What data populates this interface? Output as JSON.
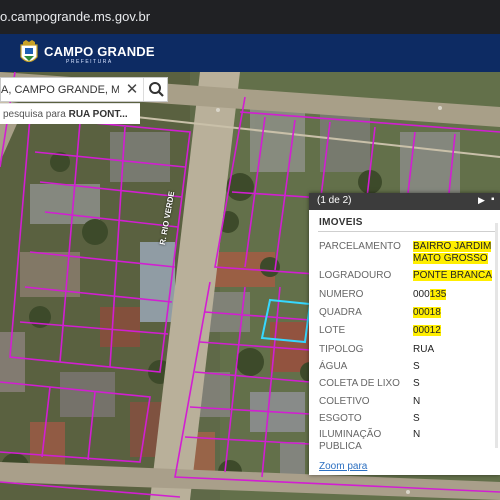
{
  "browser": {
    "url": "o.campogrande.ms.gov.br"
  },
  "header": {
    "title": "CAMPO GRANDE",
    "subtitle": "PREFEITURA"
  },
  "search": {
    "value": "A, CAMPO GRANDE, MS",
    "suggestion_prefix": "pesquisa para ",
    "suggestion_term": "RUA PONT..."
  },
  "map": {
    "street_label": "R. RIO VERDE"
  },
  "popup": {
    "count": "(1 de 2)",
    "next_icon": "play-icon",
    "title": "IMOVEIS",
    "attributes": [
      {
        "label": "PARCELAMENTO",
        "value_line1": "BAIRRO JARDIM",
        "value_line2": "MATO GROSSO",
        "highlight": true
      },
      {
        "label": "LOGRADOURO",
        "value": "PONTE BRANCA",
        "highlight": true
      },
      {
        "label": "NUMERO",
        "value_prefix": "000",
        "value_hl": "135"
      },
      {
        "label": "QUADRA",
        "value": "00018",
        "highlight": true
      },
      {
        "label": "LOTE",
        "value": "00012",
        "highlight": true
      },
      {
        "label": "TIPOLOG",
        "value": "RUA"
      },
      {
        "label": "ÁGUA",
        "value": "S"
      },
      {
        "label": "COLETA DE LIXO",
        "value": "S"
      },
      {
        "label": "COLETIVO",
        "value": "N"
      },
      {
        "label": "ESGOTO",
        "value": "S"
      },
      {
        "label": "ILUMINAÇÃO",
        "label2": "PUBLICA",
        "value": "N"
      }
    ],
    "zoom_link": "Zoom para"
  },
  "colors": {
    "header": "#0d2b63",
    "parcel_lines": "#d21ed2",
    "selected_parcel": "#36d8ff",
    "highlight": "#ffee00"
  }
}
